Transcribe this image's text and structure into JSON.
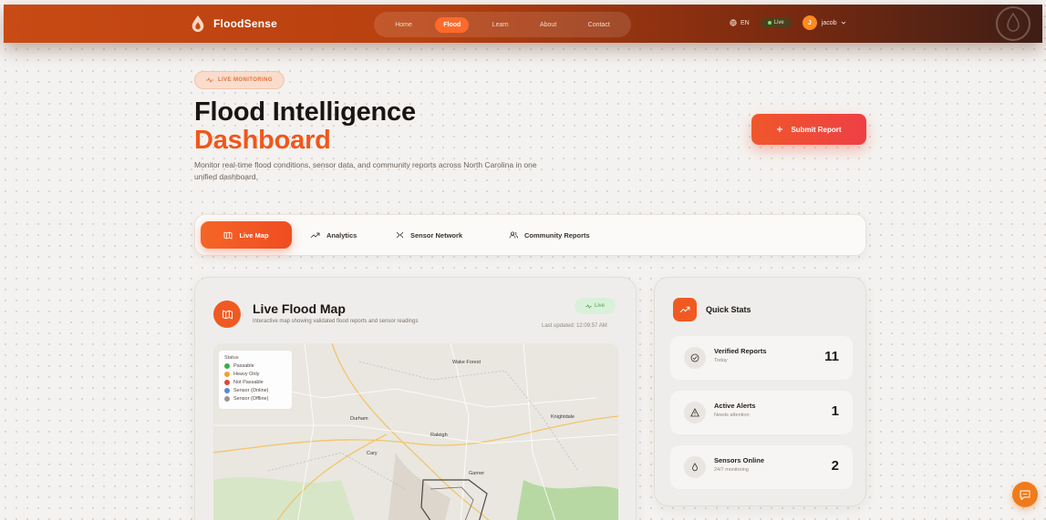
{
  "nav": {
    "brand": "FloodSense",
    "links": [
      {
        "label": "Home"
      },
      {
        "label": "Flood"
      },
      {
        "label": "Learn"
      },
      {
        "label": "About"
      },
      {
        "label": "Contact"
      }
    ],
    "active_link": "Flood",
    "language": "EN",
    "live_label": "Live",
    "user_initial": "J",
    "user_name": "jacob"
  },
  "hero": {
    "badge": "LIVE MONITORING",
    "title_line1": "Flood Intelligence",
    "title_line2": "Dashboard",
    "subtitle": "Monitor real-time flood conditions, sensor data, and community reports across North Carolina in one unified dashboard.",
    "submit_label": "Submit Report"
  },
  "tabs": [
    {
      "label": "Live Map",
      "icon": "map-icon",
      "active": true
    },
    {
      "label": "Analytics",
      "icon": "trend-icon",
      "active": false
    },
    {
      "label": "Sensor Network",
      "icon": "network-icon",
      "active": false
    },
    {
      "label": "Community Reports",
      "icon": "users-icon",
      "active": false
    }
  ],
  "map": {
    "title": "Live Flood Map",
    "subtitle": "Interactive map showing validated flood reports and sensor readings",
    "live_tag": "Live",
    "updated": "Last updated: 12:09:57 AM",
    "legend": {
      "title": "Status",
      "items": [
        {
          "label": "Passable",
          "color": "#3fae4a"
        },
        {
          "label": "Heavy Only",
          "color": "#f2a12c"
        },
        {
          "label": "Not Passable",
          "color": "#e0433a"
        },
        {
          "label": "Sensor (Online)",
          "color": "#5b86d6"
        },
        {
          "label": "Sensor (Offline)",
          "color": "#9a9590"
        }
      ]
    },
    "places": [
      "Raleigh",
      "Durham",
      "Cary",
      "Knightdale",
      "Wake Forest",
      "Garner"
    ]
  },
  "stats": {
    "title": "Quick Stats",
    "items": [
      {
        "label": "Verified Reports",
        "desc": "Today",
        "value": "11",
        "icon": "check-circle-icon"
      },
      {
        "label": "Active Alerts",
        "desc": "Needs attention",
        "value": "1",
        "icon": "warning-icon"
      },
      {
        "label": "Sensors Online",
        "desc": "24/7 monitoring",
        "value": "2",
        "icon": "sensor-icon"
      }
    ]
  },
  "colors": {
    "accent": "#f0571b",
    "nav_dark": "#3e1e16",
    "live_green": "#56a05a"
  }
}
